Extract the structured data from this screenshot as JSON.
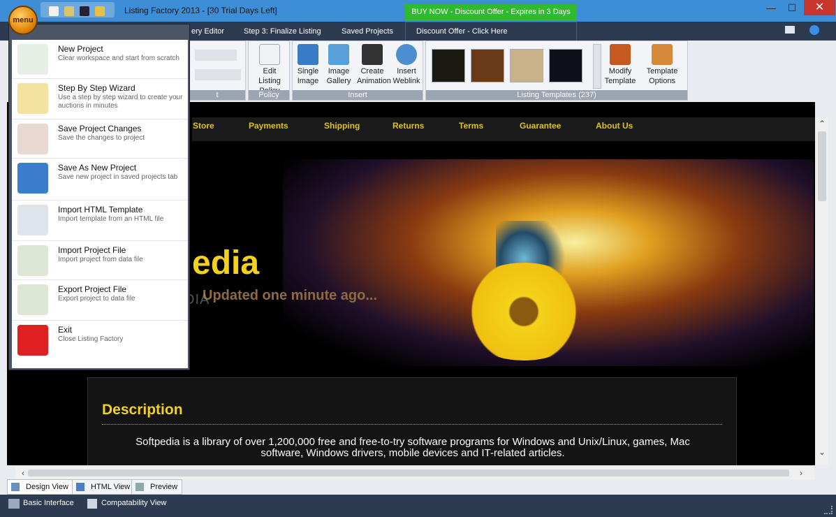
{
  "window": {
    "title": "Listing Factory 2013 - [30 Trial Days Left]",
    "buy_now": "BUY NOW - Discount Offer - Expires in 3 Days"
  },
  "tabs": [
    {
      "label": "ery Editor"
    },
    {
      "label": "Step 3: Finalize Listing"
    },
    {
      "label": "Saved Projects"
    },
    {
      "label": "Discount Offer - Click Here"
    }
  ],
  "ribbon": {
    "policy": {
      "group": "Policy",
      "edit_listing": "Edit Listing",
      "edit_policy": "Policy"
    },
    "insert": {
      "group": "Insert",
      "single_image": [
        "Single",
        "Image"
      ],
      "image_gallery": [
        "Image",
        "Gallery"
      ],
      "create_animation": [
        "Create",
        "Animation"
      ],
      "insert_weblink": [
        "Insert",
        "Weblink"
      ]
    },
    "templates": {
      "group": "Listing Templates (237)",
      "modify": [
        "Modify",
        "Template"
      ],
      "options": [
        "Template",
        "Options"
      ]
    },
    "partial_group": "t"
  },
  "menu": {
    "orb_label": "menu",
    "items": [
      {
        "title": "New Project",
        "desc": "Clear workspace and start from scratch"
      },
      {
        "title": "Step By Step Wizard",
        "desc": "Use a step by step wizard to create your auctions in minutes"
      },
      {
        "title": "Save Project Changes",
        "desc": "Save the changes to project"
      },
      {
        "title": "Save As New Project",
        "desc": "Save new project in saved projects tab"
      },
      {
        "title": "Import HTML Template",
        "desc": "Import template from an HTML file"
      },
      {
        "title": "Import Project File",
        "desc": "Import project from data file"
      },
      {
        "title": "Export Project File",
        "desc": "Export project to data file"
      },
      {
        "title": "Exit",
        "desc": "Close Listing Factory"
      }
    ]
  },
  "page": {
    "nav": [
      "Store",
      "Payments",
      "Shipping",
      "Returns",
      "Terms",
      "Guarantee",
      "About Us"
    ],
    "site_name": "edia",
    "tagline": "Updated one minute ago...",
    "watermark": "SOFTPEDIA",
    "description_title": "Description",
    "description_text": "Softpedia is a library of over 1,200,000 free and free-to-try software programs for Windows and Unix/Linux, games, Mac software, Windows drivers, mobile devices and IT-related articles."
  },
  "view_tabs": [
    "Design View",
    "HTML View",
    "Preview"
  ],
  "status": {
    "interface": "Basic Interface",
    "compat": "Compatability View"
  }
}
